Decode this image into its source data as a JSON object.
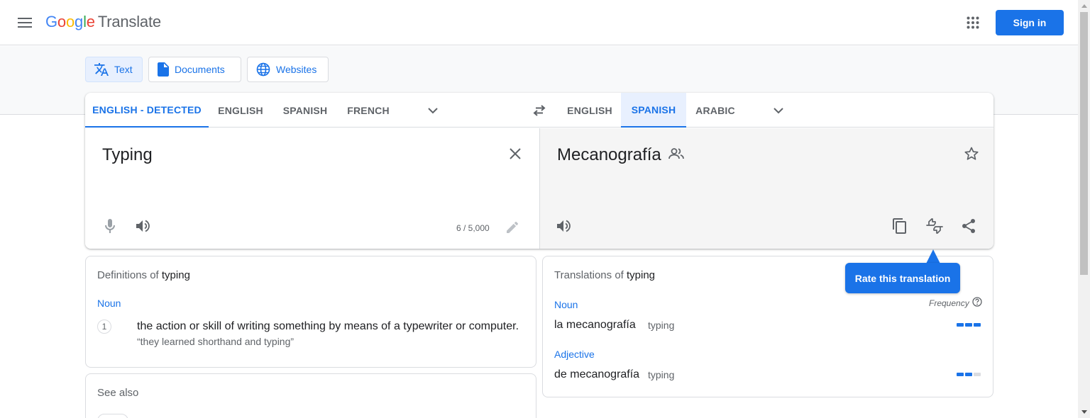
{
  "header": {
    "logo_google": [
      "G",
      "o",
      "o",
      "g",
      "l",
      "e"
    ],
    "logo_product": "Translate",
    "sign_in_label": "Sign in"
  },
  "modes": [
    {
      "label": "Text",
      "icon": "translate-icon",
      "active": true
    },
    {
      "label": "Documents",
      "icon": "document-icon",
      "active": false
    },
    {
      "label": "Websites",
      "icon": "globe-icon",
      "active": false
    }
  ],
  "source": {
    "tabs": [
      "ENGLISH - DETECTED",
      "ENGLISH",
      "SPANISH",
      "FRENCH"
    ],
    "selected_tab": "ENGLISH - DETECTED",
    "text": "Typing",
    "counter": "6 / 5,000"
  },
  "target": {
    "tabs": [
      "ENGLISH",
      "SPANISH",
      "ARABIC"
    ],
    "selected_tab": "SPANISH",
    "text": "Mecanografía"
  },
  "tooltip": "Rate this translation",
  "definitions": {
    "title_prefix": "Definitions of",
    "word": "typing",
    "pos": "Noun",
    "items": [
      {
        "num": "1",
        "text": "the action or skill of writing something by means of a typewriter or computer.",
        "example": "“they learned shorthand and typing”"
      }
    ]
  },
  "translations": {
    "title_prefix": "Translations of",
    "word": "typing",
    "frequency_label": "Frequency",
    "groups": [
      {
        "pos": "Noun",
        "word": "la mecanografía",
        "back": "typing",
        "frequency": 3
      },
      {
        "pos": "Adjective",
        "word": "de mecanografía",
        "back": "typing",
        "frequency": 2
      }
    ]
  },
  "see_also": {
    "title": "See also"
  },
  "colors": {
    "accent": "#1a73e8",
    "pane_bg": "#f5f5f5",
    "selected_tab_bg": "#e8f0fe"
  }
}
